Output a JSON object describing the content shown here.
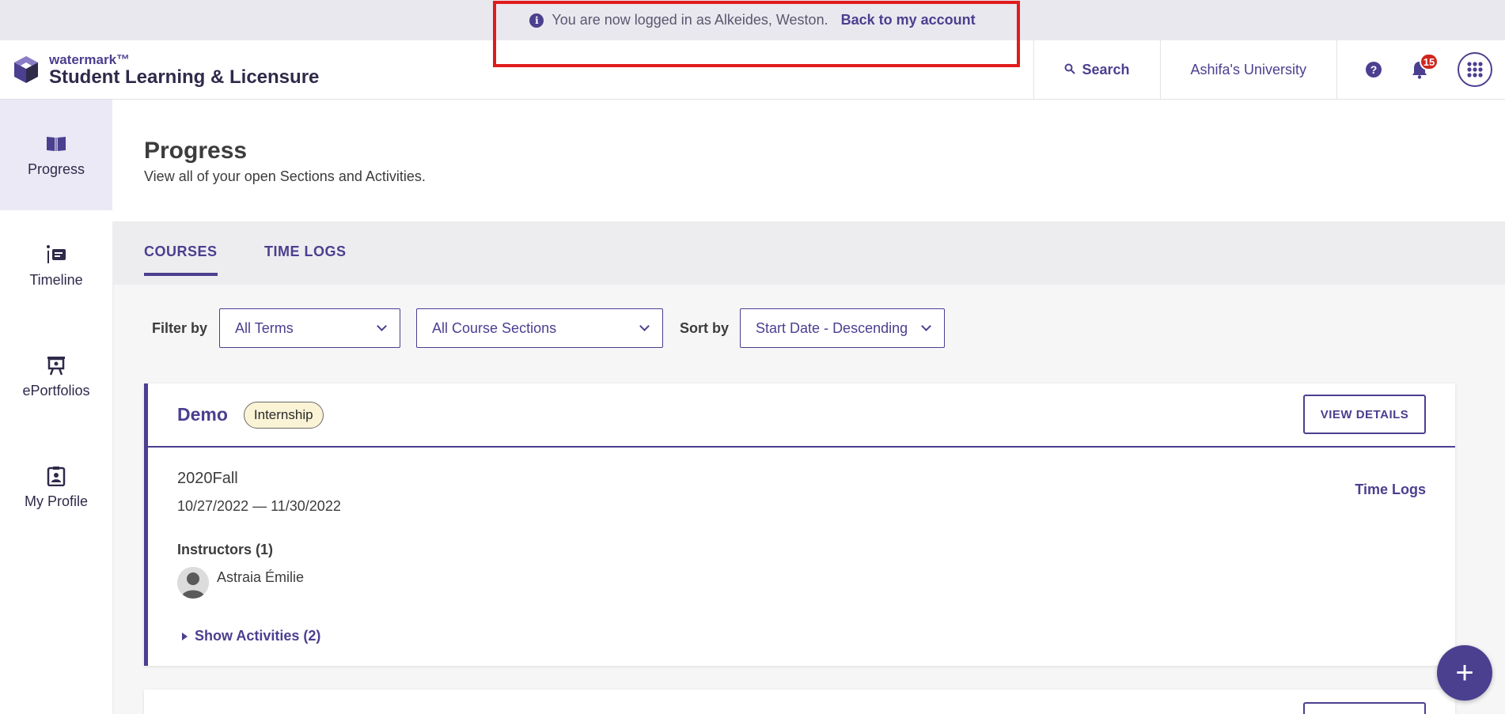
{
  "banner": {
    "message": "You are now logged in as Alkeides, Weston.",
    "back_link": "Back to my account",
    "icon": "info-icon"
  },
  "header": {
    "brand": "watermark™",
    "product": "Student Learning & Licensure",
    "search_label": "Search",
    "university": "Ashifa's University",
    "notification_count": "15",
    "help_symbol": "?",
    "accent_color": "#4b3f8f"
  },
  "sidebar": {
    "items": [
      {
        "label": "Progress",
        "icon": "open-book-icon",
        "active": true
      },
      {
        "label": "Timeline",
        "icon": "timeline-icon",
        "active": false
      },
      {
        "label": "ePortfolios",
        "icon": "easel-icon",
        "active": false
      },
      {
        "label": "My Profile",
        "icon": "id-badge-icon",
        "active": false
      }
    ]
  },
  "page": {
    "title": "Progress",
    "subtitle": "View all of your open Sections and Activities."
  },
  "tabs": [
    {
      "label": "COURSES",
      "active": true
    },
    {
      "label": "TIME LOGS",
      "active": false
    }
  ],
  "filters": {
    "filter_label": "Filter by",
    "term": "All Terms",
    "section": "All Course Sections",
    "sort_label": "Sort by",
    "sort": "Start Date - Descending"
  },
  "course_card": {
    "title": "Demo",
    "tag": "Internship",
    "view_details": "VIEW DETAILS",
    "term": "2020Fall",
    "dates": "10/27/2022 — 11/30/2022",
    "time_logs_link": "Time Logs",
    "instructors_label": "Instructors (1)",
    "instructor_name": "Astraia Émilie",
    "show_activities": "Show Activities (2)"
  },
  "fab": {
    "symbol": "+"
  }
}
